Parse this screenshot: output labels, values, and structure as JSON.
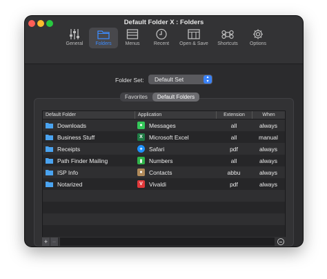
{
  "window": {
    "title": "Default Folder X : Folders"
  },
  "toolbar": {
    "items": [
      {
        "label": "General",
        "icon": "sliders-icon"
      },
      {
        "label": "Folders",
        "icon": "folder-icon",
        "active": true
      },
      {
        "label": "Menus",
        "icon": "menus-icon"
      },
      {
        "label": "Recent",
        "icon": "clock-icon"
      },
      {
        "label": "Open & Save",
        "icon": "open-save-icon"
      },
      {
        "label": "Shortcuts",
        "icon": "command-icon"
      },
      {
        "label": "Options",
        "icon": "gear-icon"
      }
    ]
  },
  "folder_set": {
    "label": "Folder Set:",
    "value": "Default Set"
  },
  "segmented": {
    "tab1": "Favorites",
    "tab2": "Default Folders",
    "selected": "Default Folders"
  },
  "table": {
    "headers": {
      "folder": "Default Folder",
      "application": "Application",
      "extension": "Extension",
      "when": "When"
    },
    "rows": [
      {
        "folder": "Downloads",
        "app": "Messages",
        "app_icon_color": "#34c759",
        "ext": "all",
        "when": "always"
      },
      {
        "folder": "Business Stuff",
        "app": "Microsoft Excel",
        "app_icon_color": "#1f7a44",
        "ext": "all",
        "when": "manual"
      },
      {
        "folder": "Receipts",
        "app": "Safari",
        "app_icon_color": "#1e90ff",
        "ext": "pdf",
        "when": "always"
      },
      {
        "folder": "Path Finder Mailing",
        "app": "Numbers",
        "app_icon_color": "#30b34a",
        "ext": "all",
        "when": "always"
      },
      {
        "folder": "ISP Info",
        "app": "Contacts",
        "app_icon_color": "#b08a5a",
        "ext": "abbu",
        "when": "always"
      },
      {
        "folder": "Notarized",
        "app": "Vivaldi",
        "app_icon_color": "#e0383a",
        "ext": "pdf",
        "when": "always"
      }
    ]
  },
  "bottom": {
    "add": "+",
    "remove": "−"
  },
  "colors": {
    "accent": "#3d8cff",
    "folder": "#4aa3f0"
  }
}
